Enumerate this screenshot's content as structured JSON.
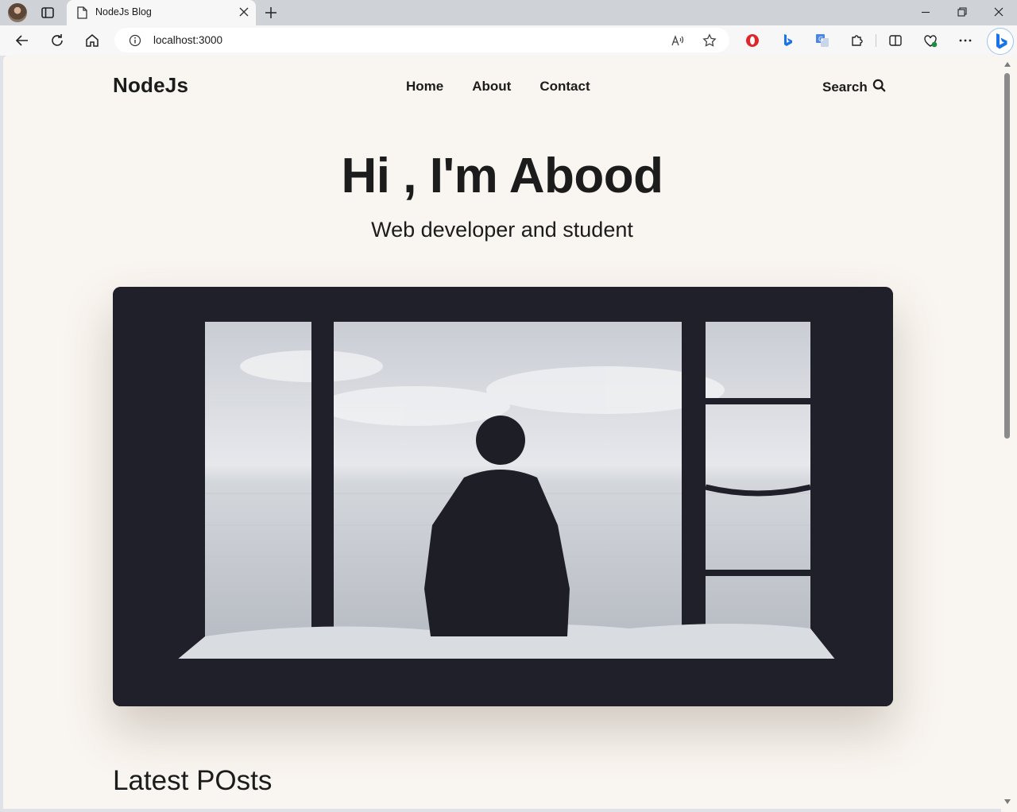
{
  "browser": {
    "tab_title": "NodeJs Blog",
    "url": "localhost:3000"
  },
  "site": {
    "logo": "NodeJs",
    "nav": [
      "Home",
      "About",
      "Contact"
    ],
    "search_label": "Search"
  },
  "hero": {
    "title": "Hi , I'm Abood",
    "subtitle": "Web developer and student"
  },
  "section": {
    "latest_title": "Latest POsts"
  },
  "colors": {
    "page_bg": "#f9f5f0",
    "text": "#1c1c1c",
    "chrome_bg": "#f7f7f7"
  }
}
